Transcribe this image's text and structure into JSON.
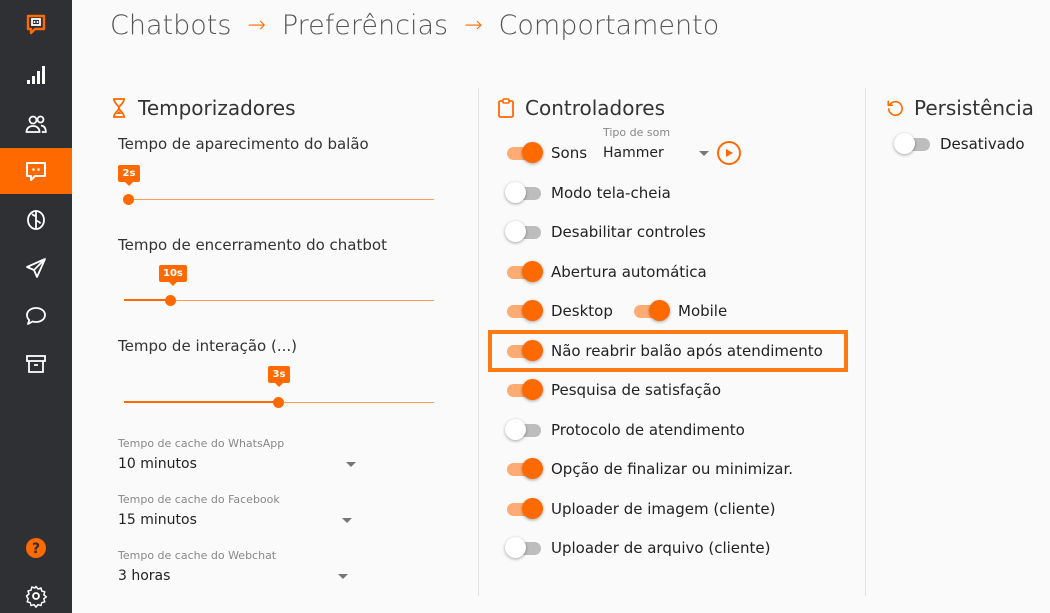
{
  "breadcrumb": {
    "items": [
      "Chatbots",
      "Preferências",
      "Comportamento"
    ],
    "separator": "→"
  },
  "sidebar": {
    "items": [
      {
        "icon": "chatbot-logo-icon",
        "active": false
      },
      {
        "icon": "signal-bars-icon",
        "active": false
      },
      {
        "icon": "users-icon",
        "active": false
      },
      {
        "icon": "chatbot-icon",
        "active": true
      },
      {
        "icon": "brain-icon",
        "active": false
      },
      {
        "icon": "paper-plane-icon",
        "active": false
      },
      {
        "icon": "chat-bubble-icon",
        "active": false
      },
      {
        "icon": "archive-icon",
        "active": false
      },
      {
        "icon": "help-icon",
        "active": false
      },
      {
        "icon": "gear-icon",
        "active": false
      }
    ]
  },
  "timers": {
    "title": "Temporizadores",
    "sliders": [
      {
        "label": "Tempo de aparecimento do balão",
        "value": "2s",
        "fraction": 0.0
      },
      {
        "label": "Tempo de encerramento do chatbot",
        "value": "10s",
        "fraction": 0.15
      },
      {
        "label": "Tempo de interação (...)",
        "value": "3s",
        "fraction": 0.5
      }
    ],
    "selects": [
      {
        "label": "Tempo de cache do WhatsApp",
        "value": "10 minutos"
      },
      {
        "label": "Tempo de cache do Facebook",
        "value": "15 minutos"
      },
      {
        "label": "Tempo de cache do Webchat",
        "value": "3 horas"
      }
    ]
  },
  "controllers": {
    "title": "Controladores",
    "sound_type": {
      "label": "Tipo de som",
      "value": "Hammer"
    },
    "toggles": {
      "sons": {
        "label": "Sons",
        "on": true
      },
      "fullscreen": {
        "label": "Modo tela-cheia",
        "on": false
      },
      "disable_controls": {
        "label": "Desabilitar controles",
        "on": false
      },
      "auto_open": {
        "label": "Abertura automática",
        "on": true
      },
      "desktop": {
        "label": "Desktop",
        "on": true
      },
      "mobile": {
        "label": "Mobile",
        "on": true
      },
      "no_reopen": {
        "label": "Não reabrir balão após atendimento",
        "on": true
      },
      "satisfaction": {
        "label": "Pesquisa de satisfação",
        "on": true
      },
      "protocol": {
        "label": "Protocolo de atendimento",
        "on": false
      },
      "finish_minimize": {
        "label": "Opção de finalizar ou minimizar.",
        "on": true
      },
      "image_uploader": {
        "label": "Uploader de imagem (cliente)",
        "on": true
      },
      "file_uploader": {
        "label": "Uploader de arquivo (cliente)",
        "on": false
      }
    }
  },
  "persistence": {
    "title": "Persistência",
    "toggle": {
      "label": "Desativado",
      "on": false
    }
  },
  "colors": {
    "accent": "#ff6a00",
    "sidebar_bg": "#2f3033",
    "page_bg": "#fafafa"
  }
}
